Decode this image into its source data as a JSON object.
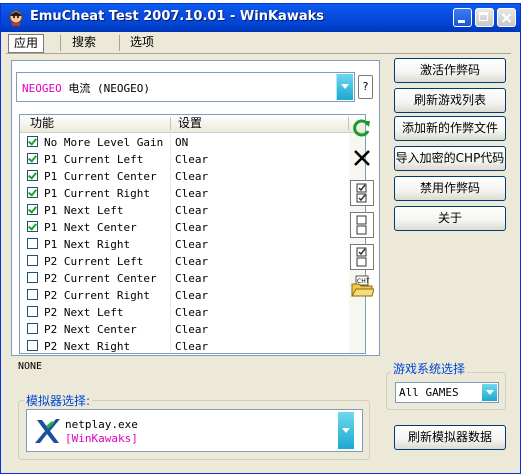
{
  "window": {
    "title": "EmuCheat Test 2007.10.01 - WinKawaks"
  },
  "menu": {
    "tabs": [
      "应用",
      "搜索",
      "选项"
    ]
  },
  "game_select": {
    "prefix": "NEOGEO",
    "label": "电流 (NEOGEO)",
    "help_label": "?"
  },
  "cheat_list": {
    "columns": {
      "feature": "功能",
      "setting": "设置"
    },
    "rows": [
      {
        "name": "No More Level Gain",
        "value": "ON",
        "checked": true
      },
      {
        "name": "P1 Current Left",
        "value": "Clear",
        "checked": true
      },
      {
        "name": "P1 Current Center",
        "value": "Clear",
        "checked": true
      },
      {
        "name": "P1 Current Right",
        "value": "Clear",
        "checked": true
      },
      {
        "name": "P1 Next Left",
        "value": "Clear",
        "checked": true
      },
      {
        "name": "P1 Next Center",
        "value": "Clear",
        "checked": true
      },
      {
        "name": "P1 Next Right",
        "value": "Clear",
        "checked": false
      },
      {
        "name": "P2 Current Left",
        "value": "Clear",
        "checked": false
      },
      {
        "name": "P2 Current Center",
        "value": "Clear",
        "checked": false
      },
      {
        "name": "P2 Current Right",
        "value": "Clear",
        "checked": false
      },
      {
        "name": "P2 Next Left",
        "value": "Clear",
        "checked": false
      },
      {
        "name": "P2 Next Center",
        "value": "Clear",
        "checked": false
      },
      {
        "name": "P2 Next Right",
        "value": "Clear",
        "checked": false
      }
    ]
  },
  "status": {
    "text": "NONE"
  },
  "emulator": {
    "legend": "模拟器选择:",
    "name": "netplay.exe",
    "sub": "[WinKawaks]"
  },
  "buttons": {
    "activate": "激活作弊码",
    "refresh_games": "刷新游戏列表",
    "add_file": "添加新的作弊文件",
    "import_chp": "导入加密的CHP代码",
    "disable": "禁用作弊码",
    "about": "关于",
    "refresh_emu": "刷新模拟器数据"
  },
  "game_system": {
    "legend": "游戏系统选择",
    "value": "All GAMES"
  },
  "icons": [
    "refresh-icon",
    "delete-icon",
    "check-all-icon",
    "uncheck-all-icon",
    "toggle-icon",
    "cht-open-icon",
    "emulator-app-icon"
  ],
  "colors": {
    "titlebar": "#0a4de2",
    "highlight_text": "#e000c0",
    "group_legend": "#0046d5",
    "combo_arrow": "#1aa9d1"
  }
}
